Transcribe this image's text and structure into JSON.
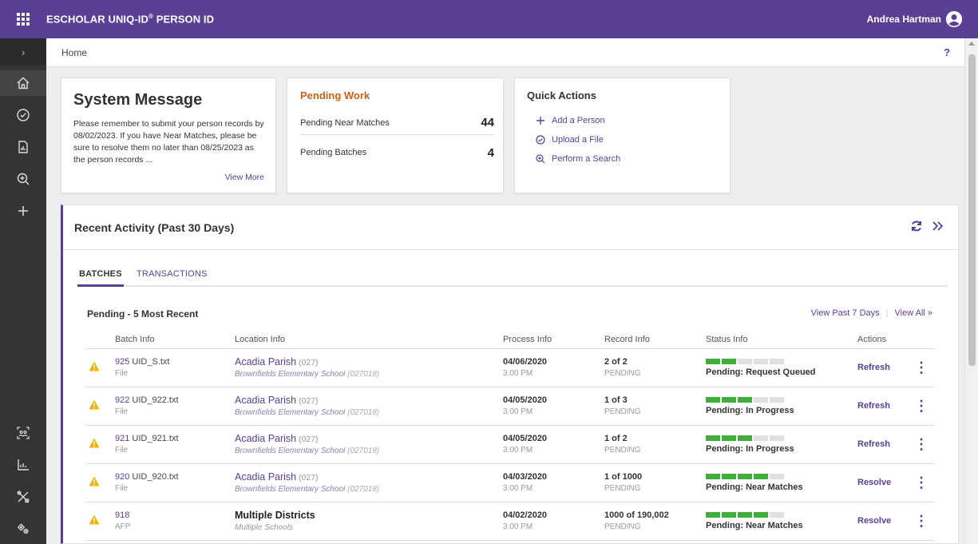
{
  "topbar": {
    "brand": "ESCHOLAR UNIQ-ID",
    "brand_reg": "®",
    "brand_suffix": " PERSON ID",
    "user_name": "Andrea Hartman"
  },
  "sidebar": {
    "collapse_icon": "chevron-right-icon",
    "items": [
      {
        "name": "home-icon"
      },
      {
        "name": "check-circle-icon"
      },
      {
        "name": "report-icon"
      },
      {
        "name": "search-zoom-icon"
      },
      {
        "name": "plus-icon"
      },
      {
        "name": "people-group-icon"
      },
      {
        "name": "chart-icon"
      },
      {
        "name": "tools-icon"
      },
      {
        "name": "settings-gears-icon"
      }
    ]
  },
  "breadcrumb": {
    "home": "Home",
    "help": "?"
  },
  "system_message": {
    "title": "System Message",
    "body": "Please remember to submit your person records by 08/02/2023. If you have Near Matches, please be sure to resolve them no later than 08/25/2023 as the person records ...",
    "view_more": "View More"
  },
  "pending_work": {
    "title": "Pending Work",
    "items": [
      {
        "label": "Pending Near Matches",
        "value": "44"
      },
      {
        "label": "Pending Batches",
        "value": "4"
      }
    ]
  },
  "quick_actions": {
    "title": "Quick Actions",
    "items": [
      {
        "label": "Add a Person",
        "icon": "plus-icon"
      },
      {
        "label": "Upload a File",
        "icon": "check-circle-icon"
      },
      {
        "label": "Perform a Search",
        "icon": "search-zoom-icon"
      }
    ]
  },
  "recent_activity": {
    "title": "Recent Activity (Past 30 Days)",
    "tabs": [
      "BATCHES",
      "TRANSACTIONS"
    ],
    "subhead": "Pending - 5 Most Recent",
    "view_past": "View Past 7 Days",
    "view_all": "View All »",
    "columns": [
      "Batch Info",
      "Location Info",
      "Process Info",
      "Record Info",
      "Status Info",
      "Actions"
    ],
    "rows": [
      {
        "id": "925",
        "file": " UID_S.txt",
        "type": "File",
        "district": "Acadia Parish",
        "district_code": " (027)",
        "school": "Brownfields Elementary School",
        "school_code": " (027018)",
        "date": "04/06/2020",
        "time": "3:00 PM",
        "records": "2 of 2",
        "rec_status": "PENDING",
        "progress": 2,
        "status": "Pending: Request Queued",
        "action": "Refresh"
      },
      {
        "id": "922",
        "file": " UID_922.txt",
        "type": "File",
        "district": "Acadia Parish",
        "district_code": " (027)",
        "school": "Brownfields Elementary School",
        "school_code": " (027018)",
        "date": "04/05/2020",
        "time": "3:00 PM",
        "records": "1 of 3",
        "rec_status": "PENDING",
        "progress": 3,
        "status": "Pending: In Progress",
        "action": "Refresh"
      },
      {
        "id": "921",
        "file": " UID_921.txt",
        "type": "File",
        "district": "Acadia Parish",
        "district_code": " (027)",
        "school": "Brownfields Elementary School",
        "school_code": " (027018)",
        "date": "04/05/2020",
        "time": "3:00 PM",
        "records": "1 of 2",
        "rec_status": "PENDING",
        "progress": 3,
        "status": "Pending: In Progress",
        "action": "Refresh"
      },
      {
        "id": "920",
        "file": " UID_920.txt",
        "type": "File",
        "district": "Acadia Parish",
        "district_code": " (027)",
        "school": "Brownfields Elementary School",
        "school_code": " (027018)",
        "date": "04/03/2020",
        "time": "3:00 PM",
        "records": "1 of 1000",
        "rec_status": "PENDING",
        "progress": 4,
        "status": "Pending: Near Matches",
        "action": "Resolve"
      },
      {
        "id": "918",
        "file": "",
        "type": "AFP",
        "district": "Multiple Districts",
        "district_code": "",
        "school": "Multiple Schools",
        "school_code": "",
        "date": "04/02/2020",
        "time": "3:00 PM",
        "records": "1000 of 190,002",
        "rec_status": "PENDING",
        "progress": 4,
        "status": "Pending: Near Matches",
        "action": "Resolve"
      }
    ]
  },
  "colors": {
    "brand": "#5b3f95",
    "accent_orange": "#c7621b",
    "progress_green": "#3fae3a",
    "warning": "#f0b400"
  }
}
